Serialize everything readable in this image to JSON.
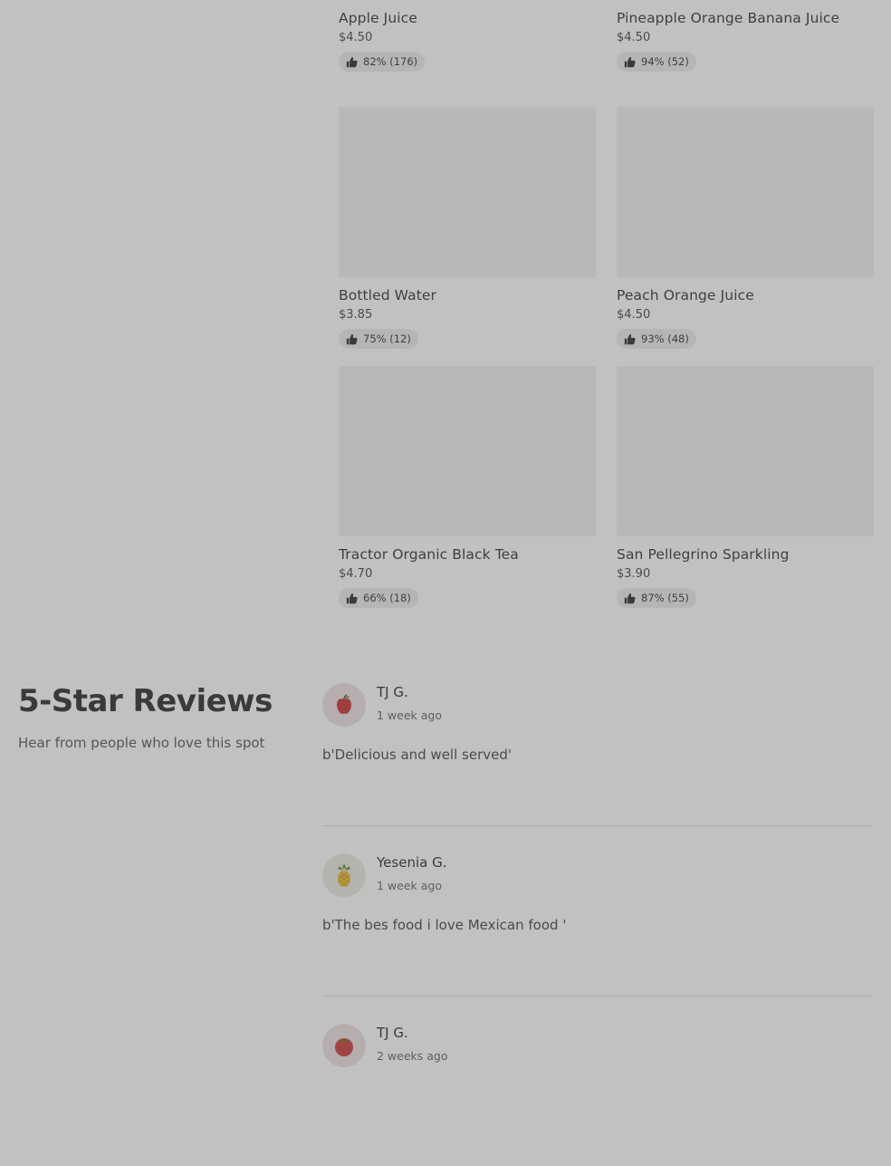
{
  "products": [
    {
      "name": "Apple Juice",
      "price": "$4.50",
      "rating": "82% (176)"
    },
    {
      "name": "Pineapple Orange Banana Juice",
      "price": "$4.50",
      "rating": "94% (52)"
    },
    {
      "name": "Bottled Water",
      "price": "$3.85",
      "rating": "75% (12)"
    },
    {
      "name": "Peach Orange Juice",
      "price": "$4.50",
      "rating": "93% (48)"
    },
    {
      "name": "Tractor Organic Black Tea",
      "price": "$4.70",
      "rating": "66% (18)"
    },
    {
      "name": "San Pellegrino Sparkling",
      "price": "$3.90",
      "rating": "87% (55)"
    }
  ],
  "reviews_section": {
    "title": "5-Star Reviews",
    "subtitle": "Hear from people who love this spot"
  },
  "reviews": [
    {
      "name": "TJ G.",
      "time": "1 week ago",
      "text": "b'Delicious and well served'",
      "avatar_icon": "apple-icon"
    },
    {
      "name": "Yesenia G.",
      "time": "1 week ago",
      "text": "b'The bes food i love Mexican food '",
      "avatar_icon": "pineapple-icon"
    },
    {
      "name": "TJ G.",
      "time": "2 weeks ago",
      "text": "",
      "avatar_icon": "tomato-icon"
    }
  ]
}
